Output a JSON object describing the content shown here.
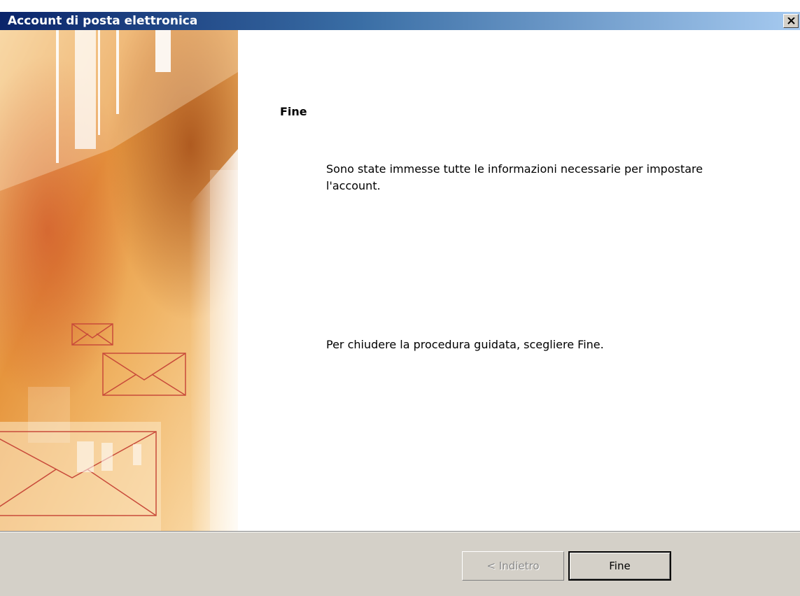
{
  "window": {
    "title": "Account di posta elettronica",
    "close_label": "Chiudi"
  },
  "wizard": {
    "heading": "Fine",
    "message": "Sono state immesse tutte le informazioni necessarie per impostare l'account.",
    "instruction": "Per chiudere la procedura guidata, scegliere Fine."
  },
  "buttons": {
    "back": "< Indietro",
    "finish": "Fine"
  },
  "colors": {
    "title_start": "#0a246a",
    "title_end": "#a6caf0",
    "dialog_face": "#d4d0c8",
    "art_orange": "#e8902f",
    "art_envelope": "#c84a3a"
  },
  "icons": {
    "close": "close-x-icon",
    "envelope": "envelope-icon"
  }
}
